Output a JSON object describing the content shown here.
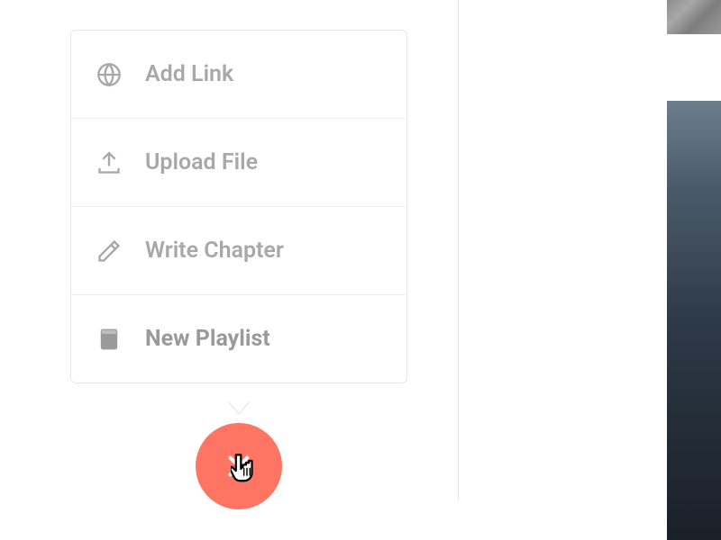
{
  "menu": {
    "items": [
      {
        "label": "Add Link",
        "icon": "globe"
      },
      {
        "label": "Upload File",
        "icon": "upload"
      },
      {
        "label": "Write Chapter",
        "icon": "pencil"
      },
      {
        "label": "New Playlist",
        "icon": "book"
      }
    ]
  },
  "fab": {
    "action": "close",
    "color": "#ff7563"
  }
}
